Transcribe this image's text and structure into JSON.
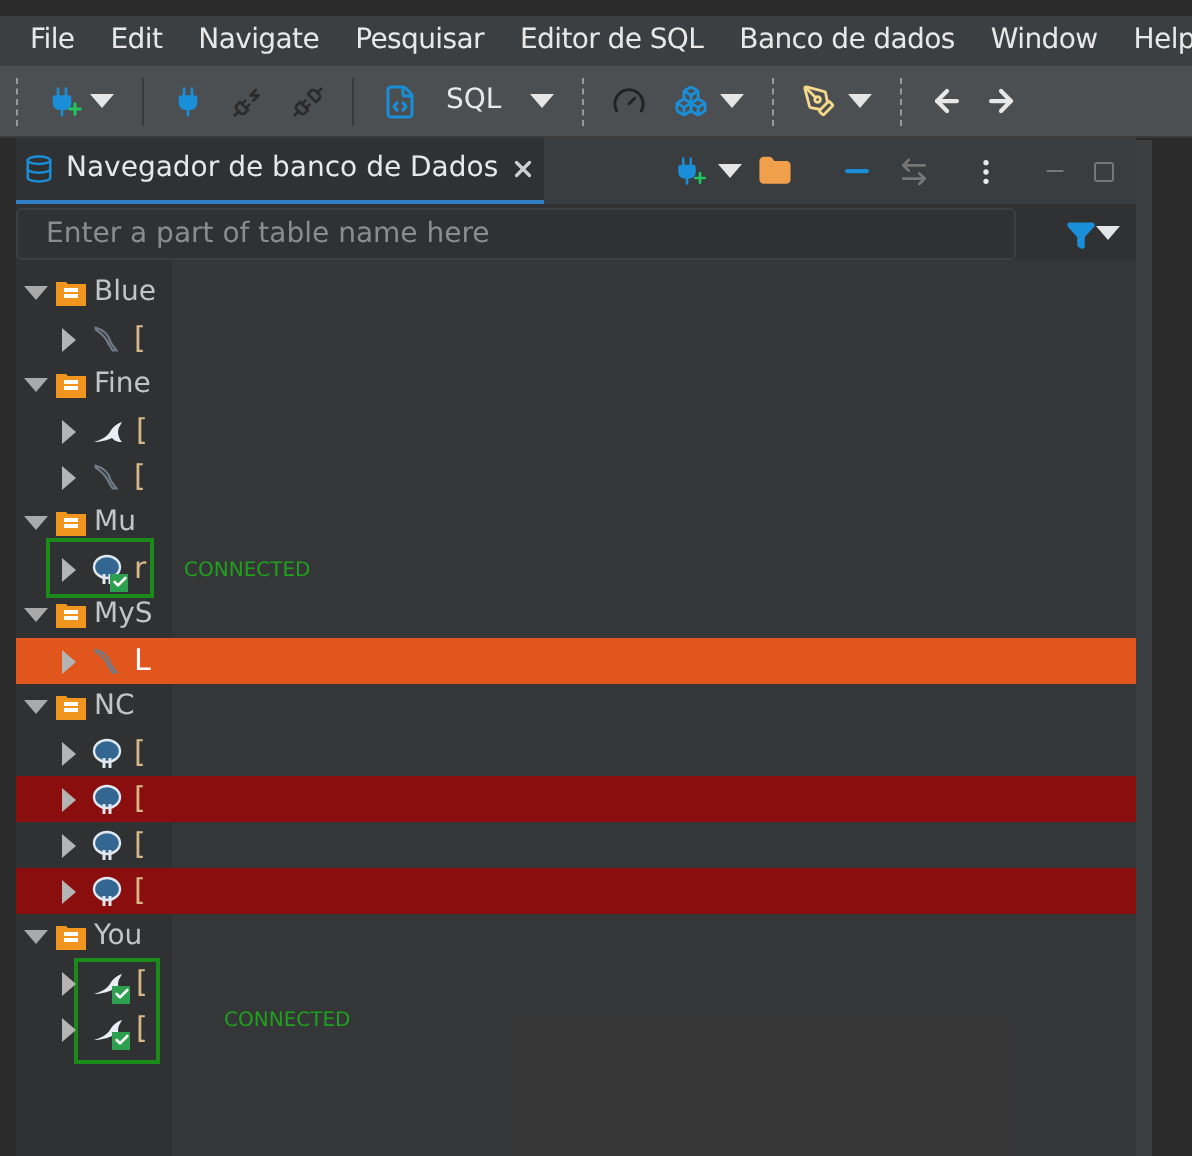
{
  "menu": [
    "File",
    "Edit",
    "Navigate",
    "Pesquisar",
    "Editor de SQL",
    "Banco de dados",
    "Window",
    "Help"
  ],
  "toolbar": {
    "sql_label": "SQL"
  },
  "panel": {
    "title": "Navegador de banco de Dados",
    "filter": {
      "placeholder": "Enter a part of table name here"
    }
  },
  "tree": [
    {
      "label": "Blue",
      "expanded": true,
      "children": [
        {
          "label": "[",
          "kind": "mysql",
          "expanded": false,
          "connected": false,
          "selected": false
        }
      ]
    },
    {
      "label": "Fine",
      "expanded": true,
      "children": [
        {
          "label": "[",
          "kind": "mariadb",
          "expanded": false,
          "connected": false,
          "selected": false
        },
        {
          "label": "[",
          "kind": "mysql",
          "expanded": false,
          "connected": false,
          "selected": false
        }
      ]
    },
    {
      "label": "Mu",
      "expanded": true,
      "children": [
        {
          "label": "r",
          "kind": "postgres",
          "expanded": false,
          "connected": true,
          "selected": false
        }
      ]
    },
    {
      "label": "MyS",
      "expanded": true,
      "children": [
        {
          "label": "L",
          "kind": "mysql",
          "expanded": false,
          "connected": false,
          "selected": true
        }
      ]
    },
    {
      "label": "NC",
      "expanded": true,
      "children": [
        {
          "label": "[",
          "kind": "postgres",
          "expanded": false,
          "connected": false,
          "selected": false
        },
        {
          "label": "[",
          "kind": "postgres",
          "expanded": false,
          "connected": false,
          "selected": false,
          "color": "#8a0e0e"
        },
        {
          "label": "[",
          "kind": "postgres",
          "expanded": false,
          "connected": false,
          "selected": false
        },
        {
          "label": "[",
          "kind": "postgres",
          "expanded": false,
          "connected": false,
          "selected": false,
          "color": "#8a0e0e"
        }
      ]
    },
    {
      "label": "You",
      "expanded": true,
      "children": [
        {
          "label": "[",
          "kind": "mariadb",
          "expanded": false,
          "connected": true,
          "selected": false
        },
        {
          "label": "[",
          "kind": "mariadb",
          "expanded": false,
          "connected": true,
          "selected": false
        }
      ]
    }
  ],
  "annotations": [
    {
      "label": "CONNECTED"
    },
    {
      "label": "CONNECTED"
    }
  ]
}
